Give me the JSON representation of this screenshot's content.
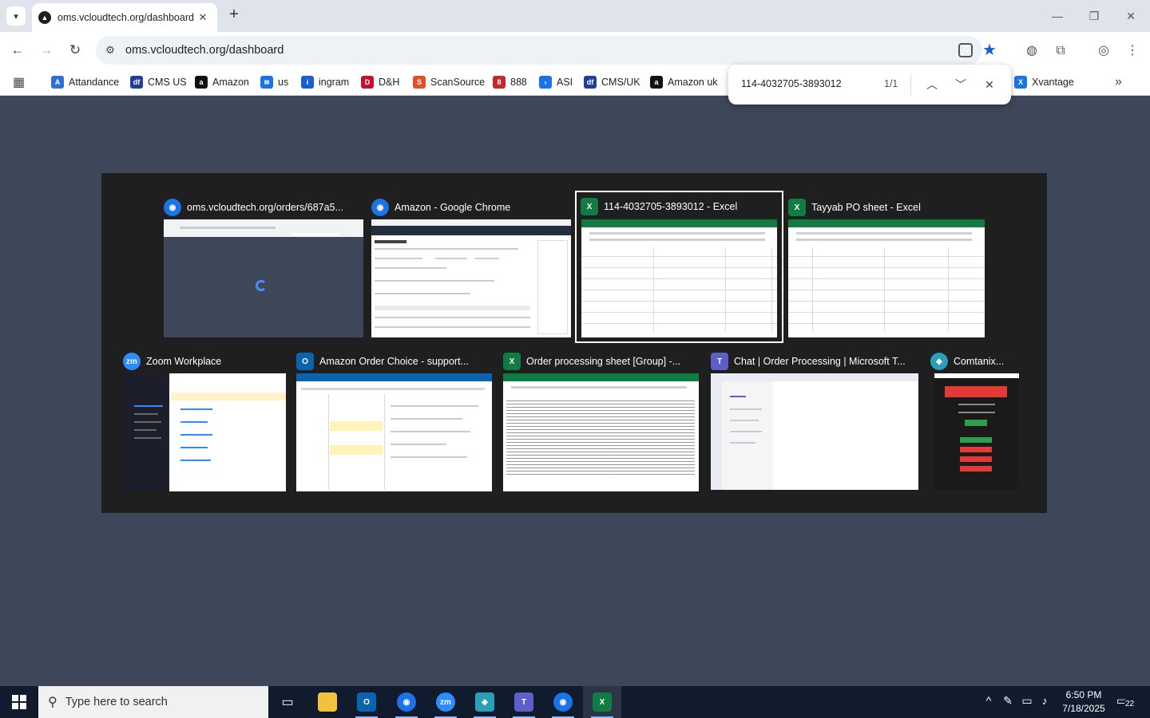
{
  "browser": {
    "active_tab_title": "oms.vcloudtech.org/dashboard",
    "url": "oms.vcloudtech.org/dashboard",
    "new_tab_symbol": "+",
    "tab_close_symbol": "✕"
  },
  "bookmarks": [
    {
      "label": "Attandance",
      "color": "#2d6fd6",
      "icon": "A"
    },
    {
      "label": "CMS US",
      "color": "#1e3f9e",
      "icon": "df"
    },
    {
      "label": "Amazon",
      "color": "#111111",
      "icon": "a"
    },
    {
      "label": "us",
      "color": "#1a73e8",
      "icon": "≋"
    },
    {
      "label": "ingram",
      "color": "#1a5bd6",
      "icon": "i"
    },
    {
      "label": "D&H",
      "color": "#c8102e",
      "icon": "D"
    },
    {
      "label": "ScanSource",
      "color": "#e44d26",
      "icon": "S"
    },
    {
      "label": "888",
      "color": "#c62828",
      "icon": "8"
    },
    {
      "label": "ASI",
      "color": "#1a73e8",
      "icon": "›"
    },
    {
      "label": "CMS/UK",
      "color": "#1e3f9e",
      "icon": "df"
    },
    {
      "label": "Amazon uk",
      "color": "#111111",
      "icon": "a"
    },
    {
      "label": "Xvantage",
      "color": "#1a73e8",
      "icon": "X"
    }
  ],
  "find_bar": {
    "query": "114-4032705-3893012",
    "count": "1/1"
  },
  "switcher_windows": [
    {
      "title": "oms.vcloudtech.org/orders/687a5...",
      "icon": "chrome-icon",
      "color": "#1a73e8",
      "letter": "◉"
    },
    {
      "title": "Amazon - Google Chrome",
      "icon": "chrome-icon",
      "color": "#1a73e8",
      "letter": "◉"
    },
    {
      "title": "114-4032705-3893012 - Excel",
      "icon": "excel-icon",
      "color": "#107c41",
      "letter": "X"
    },
    {
      "title": "Tayyab PO sheet - Excel",
      "icon": "excel-icon",
      "color": "#107c41",
      "letter": "X"
    },
    {
      "title": "Zoom Workplace",
      "icon": "zoom-icon",
      "color": "#2d8cff",
      "letter": "zm"
    },
    {
      "title": "Amazon Order Choice - support...",
      "icon": "outlook-icon",
      "color": "#0a64ad",
      "letter": "O"
    },
    {
      "title": "Order processing sheet  [Group] -...",
      "icon": "excel-icon",
      "color": "#107c41",
      "letter": "X"
    },
    {
      "title": "Chat | Order Processing | Microsoft T...",
      "icon": "teams-icon",
      "color": "#5b5fc7",
      "letter": "T"
    },
    {
      "title": "Comtanix...",
      "icon": "comtanix-icon",
      "color": "#2a9fb8",
      "letter": "◆"
    }
  ],
  "taskbar": {
    "search_placeholder": "Type here to search",
    "time": "6:50 PM",
    "date": "7/18/2025",
    "notification_count": "22"
  }
}
